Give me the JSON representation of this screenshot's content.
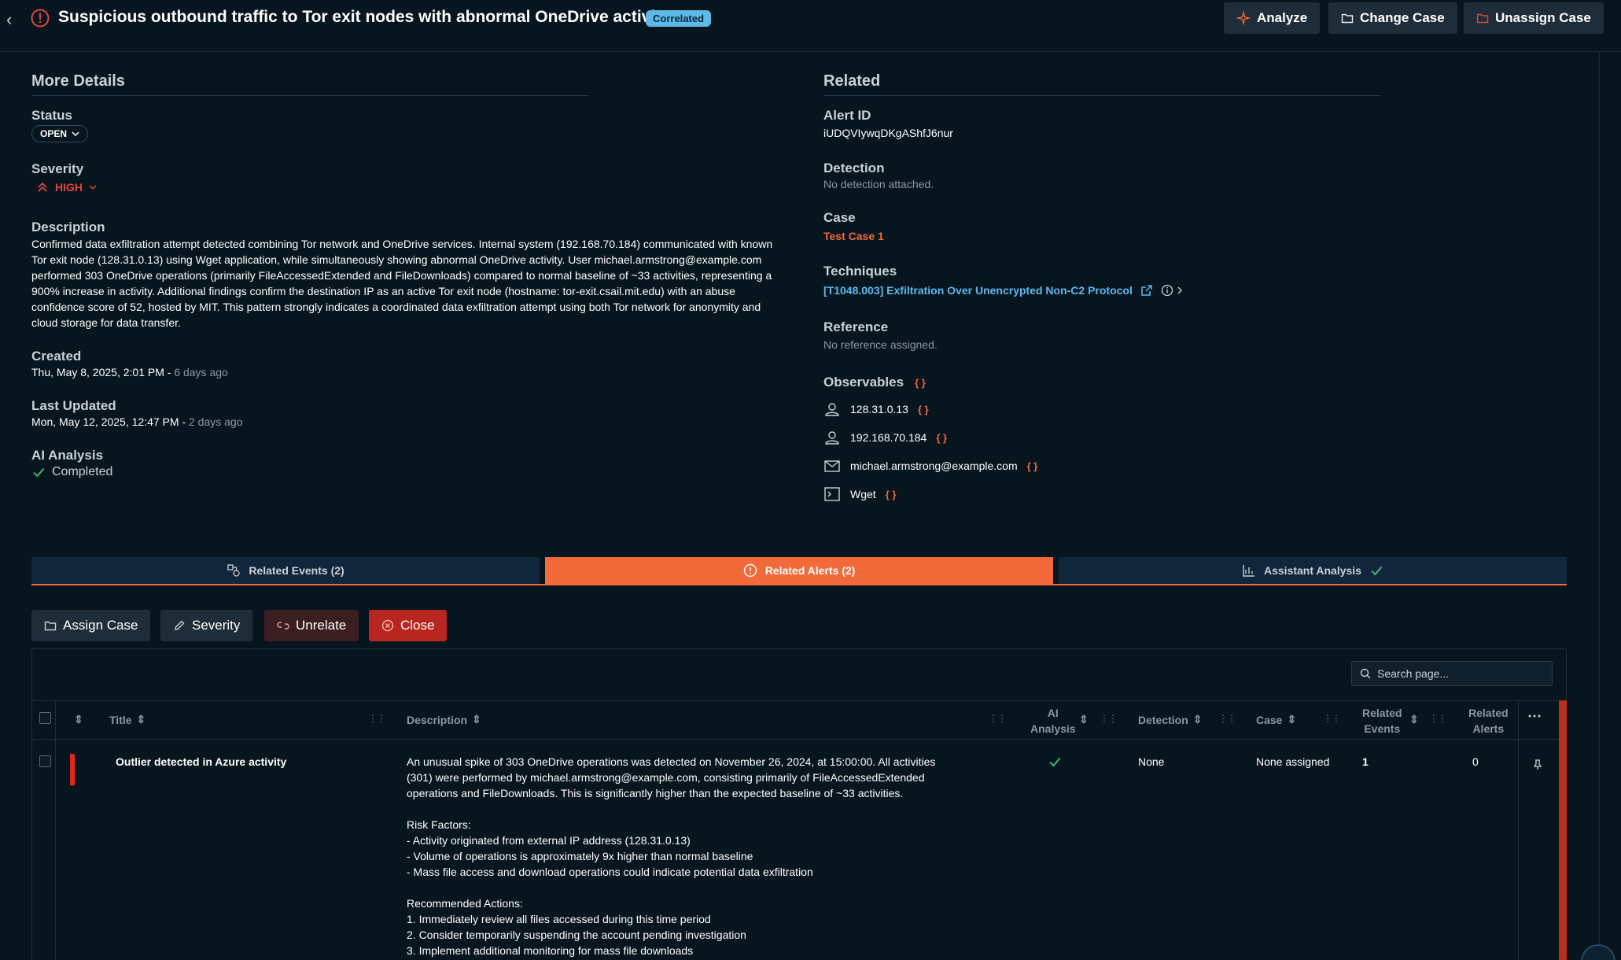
{
  "header": {
    "title": "Suspicious outbound traffic to Tor exit nodes with abnormal OneDrive activity",
    "badge": "Correlated",
    "analyze_label": "Analyze",
    "change_case_label": "Change Case",
    "unassign_case_label": "Unassign Case"
  },
  "details": {
    "heading": "More Details",
    "status_label": "Status",
    "status_value": "OPEN",
    "severity_label": "Severity",
    "severity_value": "HIGH",
    "description_label": "Description",
    "description": "Confirmed data exfiltration attempt detected combining Tor network and OneDrive services. Internal system (192.168.70.184) communicated with known Tor exit node (128.31.0.13) using Wget application, while simultaneously showing abnormal OneDrive activity. User michael.armstrong@example.com performed 303 OneDrive operations (primarily FileAccessedExtended and FileDownloads) compared to normal baseline of ~33 activities, representing a 900% increase in activity. Additional findings confirm the destination IP as an active Tor exit node (hostname: tor-exit.csail.mit.edu) with an abuse confidence score of 52, hosted by MIT. This pattern strongly indicates a coordinated data exfiltration attempt using both Tor network for anonymity and cloud storage for data transfer.",
    "created_label": "Created",
    "created_value": "Thu, May 8, 2025, 2:01 PM -",
    "created_ago": "6 days ago",
    "updated_label": "Last Updated",
    "updated_value": "Mon, May 12, 2025, 12:47 PM -",
    "updated_ago": "2 days ago",
    "ai_label": "AI Analysis",
    "ai_value": "Completed"
  },
  "related": {
    "heading": "Related",
    "alert_id_label": "Alert ID",
    "alert_id": "iUDQVIywqDKgAShfJ6nur",
    "detection_label": "Detection",
    "detection_value": "No detection attached.",
    "case_label": "Case",
    "case_value": "Test Case 1",
    "techniques_label": "Techniques",
    "technique": "[T1048.003] Exfiltration Over Unencrypted Non-C2 Protocol",
    "reference_label": "Reference",
    "reference_value": "No reference assigned.",
    "observables_label": "Observables",
    "observables": [
      {
        "value": "128.31.0.13",
        "icon": "user-icon"
      },
      {
        "value": "192.168.70.184",
        "icon": "user-icon"
      },
      {
        "value": "michael.armstrong@example.com",
        "icon": "mail-icon"
      },
      {
        "value": "Wget",
        "icon": "terminal-icon"
      }
    ],
    "brace": "{ }"
  },
  "tabs": {
    "events": "Related Events (2)",
    "alerts": "Related Alerts (2)",
    "assistant": "Assistant Analysis"
  },
  "actions": {
    "assign": "Assign Case",
    "severity": "Severity",
    "unrelate": "Unrelate",
    "close": "Close"
  },
  "search": {
    "placeholder": "Search page..."
  },
  "table": {
    "headers": {
      "title": "Title",
      "description": "Description",
      "ai_1": "AI",
      "ai_2": "Analysis",
      "detection": "Detection",
      "case": "Case",
      "rel_events_1": "Related",
      "rel_events_2": "Events",
      "rel_alerts_1": "Related",
      "rel_alerts_2": "Alerts"
    },
    "row": {
      "title": "Outlier detected in Azure activity",
      "description_lines": [
        "An unusual spike of 303 OneDrive operations was detected on November 26, 2024, at 15:00:00. All activities",
        "(301) were performed by michael.armstrong@example.com, consisting primarily of FileAccessedExtended",
        "operations and FileDownloads. This is significantly higher than the expected baseline of ~33 activities.",
        "",
        "Risk Factors:",
        "- Activity originated from external IP address (128.31.0.13)",
        "- Volume of operations is approximately 9x higher than normal baseline",
        "- Mass file access and download operations could indicate potential data exfiltration",
        "",
        "Recommended Actions:",
        "1. Immediately review all files accessed during this time period",
        "2. Consider temporarily suspending the account pending investigation",
        "3. Implement additional monitoring for mass file downloads"
      ],
      "detection": "None",
      "case": "None assigned",
      "related_events": "1",
      "related_alerts": "0"
    }
  },
  "colors": {
    "accent": "#f26a3a",
    "link": "#5cb9ef",
    "danger": "#e3453a",
    "background": "#07151f"
  }
}
